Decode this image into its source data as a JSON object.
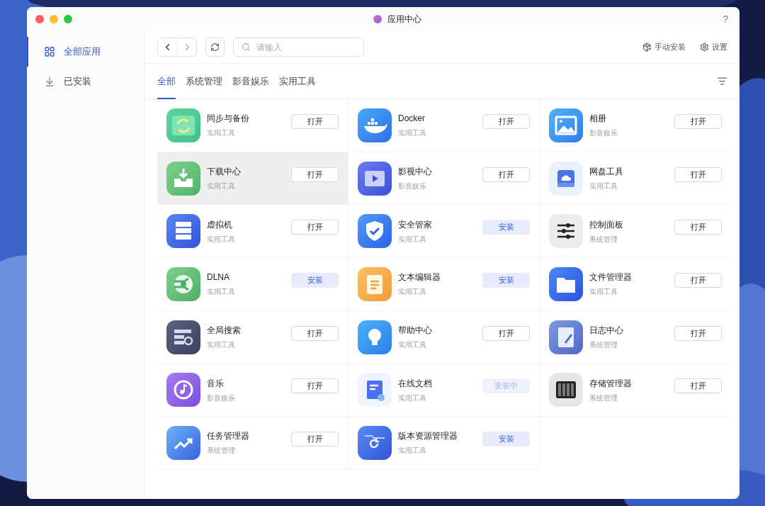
{
  "window": {
    "title": "应用中心",
    "help": "?"
  },
  "sidebar": {
    "items": [
      {
        "label": "全部应用",
        "selected": true
      },
      {
        "label": "已安装",
        "selected": false
      }
    ]
  },
  "toolbar": {
    "search": {
      "placeholder": "请输入"
    },
    "actions": [
      {
        "label": "手动安装"
      },
      {
        "label": "设置"
      }
    ]
  },
  "tabs": [
    {
      "label": "全部",
      "selected": true
    },
    {
      "label": "系统管理",
      "selected": false
    },
    {
      "label": "影音娱乐",
      "selected": false
    },
    {
      "label": "实用工具",
      "selected": false
    }
  ],
  "apps": [
    {
      "name": "同步与备份",
      "category": "实用工具",
      "action": {
        "kind": "open",
        "label": "打开"
      },
      "highlighted": false
    },
    {
      "name": "Docker",
      "category": "实用工具",
      "action": {
        "kind": "open",
        "label": "打开"
      },
      "highlighted": false
    },
    {
      "name": "相册",
      "category": "影音娱乐",
      "action": {
        "kind": "open",
        "label": "打开"
      },
      "highlighted": false
    },
    {
      "name": "下载中心",
      "category": "实用工具",
      "action": {
        "kind": "open",
        "label": "打开"
      },
      "highlighted": true
    },
    {
      "name": "影视中心",
      "category": "影音娱乐",
      "action": {
        "kind": "open",
        "label": "打开"
      },
      "highlighted": false
    },
    {
      "name": "网盘工具",
      "category": "实用工具",
      "action": {
        "kind": "open",
        "label": "打开"
      },
      "highlighted": false
    },
    {
      "name": "虚拟机",
      "category": "实用工具",
      "action": {
        "kind": "open",
        "label": "打开"
      },
      "highlighted": false
    },
    {
      "name": "安全管家",
      "category": "实用工具",
      "action": {
        "kind": "install",
        "label": "安装"
      },
      "highlighted": false
    },
    {
      "name": "控制面板",
      "category": "系统管理",
      "action": {
        "kind": "open",
        "label": "打开"
      },
      "highlighted": false
    },
    {
      "name": "DLNA",
      "category": "实用工具",
      "action": {
        "kind": "install",
        "label": "安装"
      },
      "highlighted": false
    },
    {
      "name": "文本编辑器",
      "category": "实用工具",
      "action": {
        "kind": "install",
        "label": "安装"
      },
      "highlighted": false
    },
    {
      "name": "文件管理器",
      "category": "实用工具",
      "action": {
        "kind": "open",
        "label": "打开"
      },
      "highlighted": false
    },
    {
      "name": "全局搜索",
      "category": "实用工具",
      "action": {
        "kind": "open",
        "label": "打开"
      },
      "highlighted": false
    },
    {
      "name": "帮助中心",
      "category": "实用工具",
      "action": {
        "kind": "open",
        "label": "打开"
      },
      "highlighted": false
    },
    {
      "name": "日志中心",
      "category": "系统管理",
      "action": {
        "kind": "open",
        "label": "打开"
      },
      "highlighted": false
    },
    {
      "name": "音乐",
      "category": "影音娱乐",
      "action": {
        "kind": "open",
        "label": "打开"
      },
      "highlighted": false
    },
    {
      "name": "在线文档",
      "category": "实用工具",
      "action": {
        "kind": "installing",
        "label": "安装中"
      },
      "highlighted": false
    },
    {
      "name": "存储管理器",
      "category": "系统管理",
      "action": {
        "kind": "open",
        "label": "打开"
      },
      "highlighted": false
    },
    {
      "name": "任务管理器",
      "category": "系统管理",
      "action": {
        "kind": "open",
        "label": "打开"
      },
      "highlighted": false
    },
    {
      "name": "版本资源管理器",
      "category": "实用工具",
      "action": {
        "kind": "install",
        "label": "安装"
      },
      "highlighted": false
    }
  ]
}
